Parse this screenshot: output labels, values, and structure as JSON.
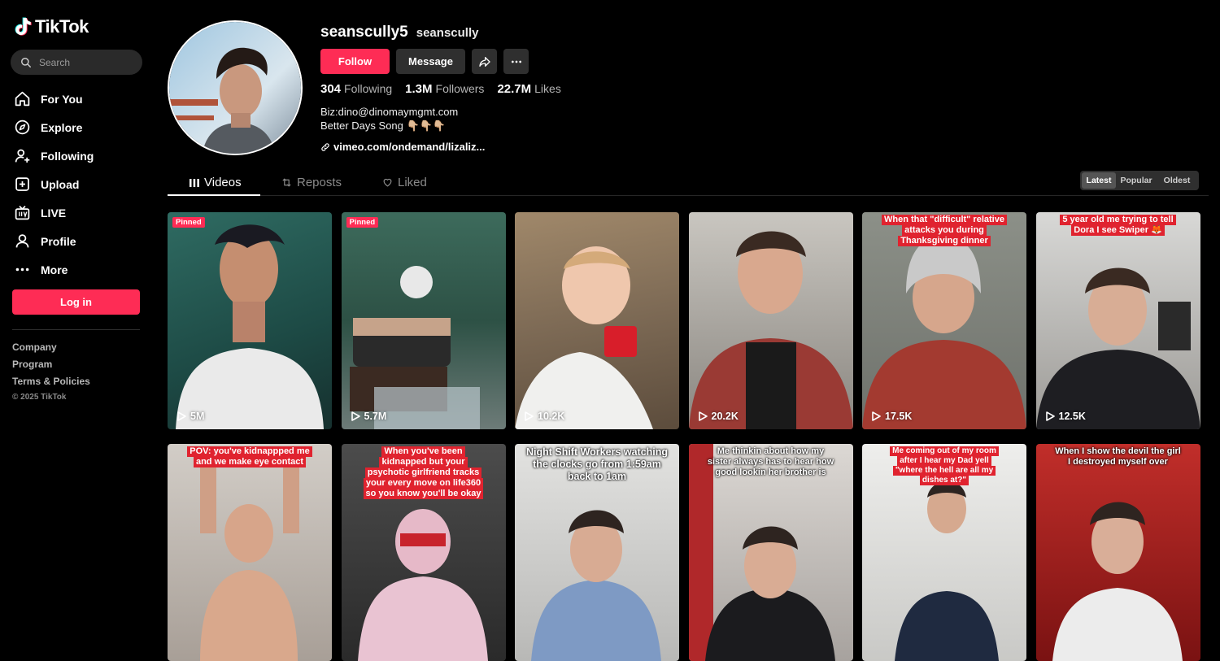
{
  "app": {
    "logo_text": "TikTok"
  },
  "search": {
    "placeholder": "Search"
  },
  "nav": [
    {
      "label": "For You",
      "icon": "home-icon"
    },
    {
      "label": "Explore",
      "icon": "compass-icon"
    },
    {
      "label": "Following",
      "icon": "following-icon"
    },
    {
      "label": "Upload",
      "icon": "upload-icon"
    },
    {
      "label": "LIVE",
      "icon": "live-icon"
    },
    {
      "label": "Profile",
      "icon": "profile-icon"
    },
    {
      "label": "More",
      "icon": "more-icon"
    }
  ],
  "login_label": "Log in",
  "footer": {
    "company": "Company",
    "program": "Program",
    "terms": "Terms & Policies",
    "copyright": "© 2025 TikTok"
  },
  "profile": {
    "username": "seanscully5",
    "nickname": "seanscully",
    "follow_label": "Follow",
    "message_label": "Message",
    "following_count": "304",
    "following_label": "Following",
    "followers_count": "1.3M",
    "followers_label": "Followers",
    "likes_count": "22.7M",
    "likes_label": "Likes",
    "bio_line1": "Biz:dino@dinomaymgmt.com",
    "bio_line2": "Better Days Song 👇🏼👇🏼👇🏼",
    "link": "vimeo.com/ondemand/lizaliz..."
  },
  "tabs": {
    "videos": "Videos",
    "reposts": "Reposts",
    "liked": "Liked"
  },
  "sort": {
    "latest": "Latest",
    "popular": "Popular",
    "oldest": "Oldest"
  },
  "pinned_label": "Pinned",
  "videos": [
    {
      "views": "5M",
      "pinned": true,
      "caption": []
    },
    {
      "views": "5.7M",
      "pinned": true,
      "caption": []
    },
    {
      "views": "10.2K",
      "pinned": false,
      "caption": []
    },
    {
      "views": "20.2K",
      "pinned": false,
      "caption": []
    },
    {
      "views": "17.5K",
      "pinned": false,
      "caption": [
        "When that \"difficult\" relative",
        "attacks you during",
        "Thanksgiving dinner"
      ]
    },
    {
      "views": "12.5K",
      "pinned": false,
      "caption": [
        "5 year old me trying to tell",
        "Dora I see Swiper 🦊"
      ]
    },
    {
      "views": "",
      "pinned": false,
      "caption": [
        "POV: you've kidnappped me",
        "and we make eye contact"
      ]
    },
    {
      "views": "",
      "pinned": false,
      "caption": [
        "When you've been",
        "kidnapped but your",
        "psychotic girlfriend tracks",
        "your every move on life360",
        "so you know you'll be okay"
      ]
    },
    {
      "views": "",
      "pinned": false,
      "caption": [
        "Night Shift Workers watching",
        "the clocks go from 1:59am",
        "back to 1am"
      ]
    },
    {
      "views": "",
      "pinned": false,
      "caption": [
        "Me thinkin about how my",
        "sister always has to hear how",
        "good lookin her brother is"
      ]
    },
    {
      "views": "",
      "pinned": false,
      "caption": [
        "Me coming out of my room",
        "after I hear my Dad yell",
        "\"where the hell are all my",
        "dishes at?\""
      ]
    },
    {
      "views": "",
      "pinned": false,
      "caption": [
        "When I show the devil the girl",
        "I destroyed myself over"
      ]
    }
  ]
}
